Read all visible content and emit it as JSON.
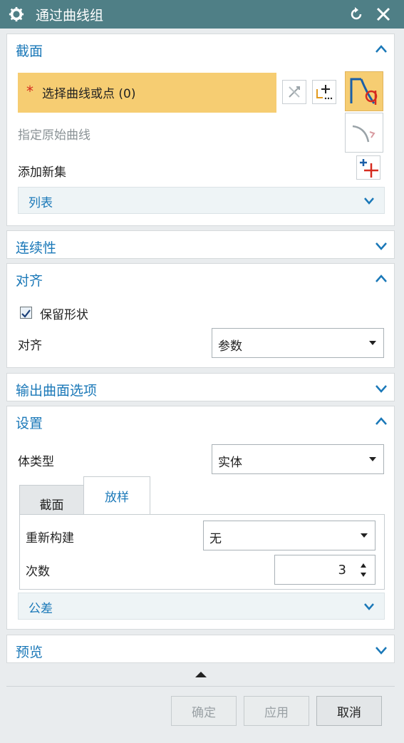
{
  "title": "通过曲线组",
  "section": {
    "label": "截面",
    "select_curve": "选择曲线或点 (0)",
    "star": "*",
    "specify_origin": "指定原始曲线",
    "add_new_set": "添加新集",
    "list_label": "列表"
  },
  "continuity": {
    "label": "连续性"
  },
  "alignment": {
    "label": "对齐",
    "keep_shape": "保留形状",
    "align_label": "对齐",
    "align_value": "参数"
  },
  "output_options": {
    "label": "输出曲面选项"
  },
  "settings": {
    "label": "设置",
    "body_type_label": "体类型",
    "body_type_value": "实体",
    "tabs": [
      "截面",
      "放样"
    ],
    "rebuild_label": "重新构建",
    "rebuild_value": "无",
    "degree_label": "次数",
    "degree_value": "3",
    "tolerance_label": "公差"
  },
  "preview": {
    "label": "预览"
  },
  "buttons": {
    "ok": "确定",
    "apply": "应用",
    "cancel": "取消"
  }
}
